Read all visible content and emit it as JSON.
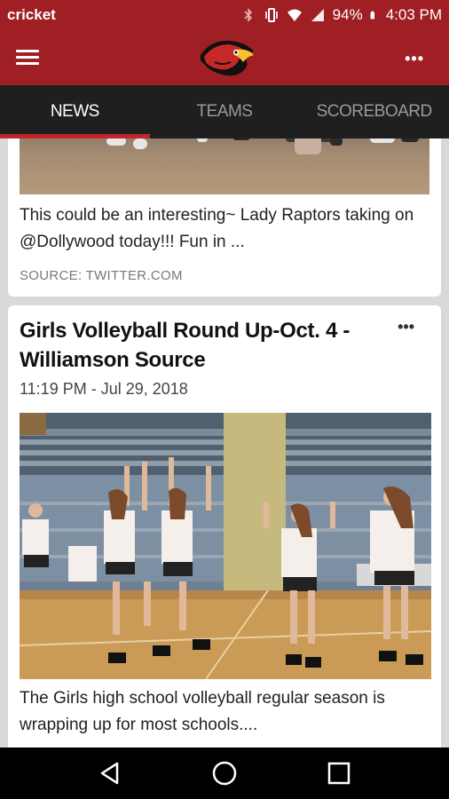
{
  "status_bar": {
    "carrier": "cricket",
    "battery": "94%",
    "time": "4:03 PM",
    "icons": [
      "bluetooth-icon",
      "vibrate-icon",
      "wifi-icon",
      "signal-icon",
      "battery-icon"
    ]
  },
  "app_bar": {
    "logo": "raptor-logo",
    "menu_icon": "hamburger-icon",
    "overflow_label": "•••"
  },
  "tabs": [
    {
      "label": "NEWS",
      "active": true
    },
    {
      "label": "TEAMS",
      "active": false
    },
    {
      "label": "SCOREBOARD",
      "active": false
    }
  ],
  "feed": {
    "items": [
      {
        "text": "This could be an interesting~ Lady Raptors taking on @Dollywood today!!! Fun in ...",
        "source": "SOURCE: TWITTER.COM"
      },
      {
        "headline": "Girls Volleyball Round Up-Oct. 4 - Williamson Source",
        "date": "11:19 PM - Jul 29, 2018",
        "menu_label": "•••",
        "text": "The Girls high school volleyball regular season is wrapping up for most schools...."
      }
    ]
  },
  "nav_bar": {
    "buttons": [
      "back-icon",
      "home-icon",
      "recents-icon"
    ]
  },
  "colors": {
    "brand_red": "#a01f24",
    "tab_bar": "#1f1f1f",
    "active_indicator": "#c0262c"
  }
}
